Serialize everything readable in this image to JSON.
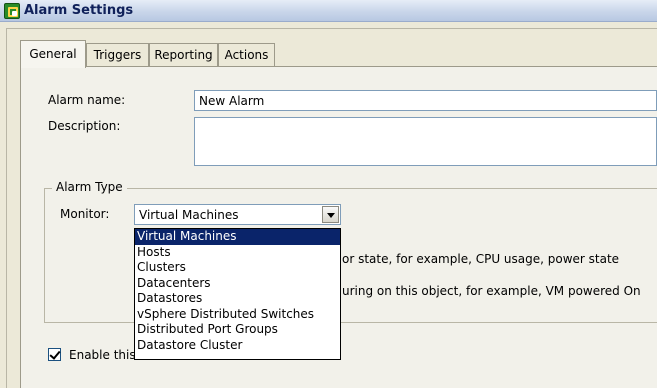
{
  "window": {
    "title": "Alarm Settings"
  },
  "tabs": [
    {
      "label": "General",
      "active": true
    },
    {
      "label": "Triggers",
      "active": false
    },
    {
      "label": "Reporting",
      "active": false
    },
    {
      "label": "Actions",
      "active": false
    }
  ],
  "general": {
    "alarm_name_label": "Alarm name:",
    "alarm_name_value": "New Alarm",
    "description_label": "Description:",
    "description_value": ""
  },
  "alarm_type": {
    "title": "Alarm Type",
    "monitor_label": "Monitor:",
    "monitor_value": "Virtual Machines",
    "options": [
      "Virtual Machines",
      "Hosts",
      "Clusters",
      "Datacenters",
      "Datastores",
      "vSphere Distributed Switches",
      "Distributed Port Groups",
      "Datastore Cluster"
    ],
    "option_line1_partial": "or state, for example, CPU usage, power state",
    "option_line2_partial": "uring on this object, for example, VM powered On"
  },
  "enable": {
    "label": "Enable this alarm",
    "checked": true
  },
  "colors": {
    "selection": "#0a246a",
    "panel": "#f2f1ea",
    "title_text": "#10215a"
  }
}
